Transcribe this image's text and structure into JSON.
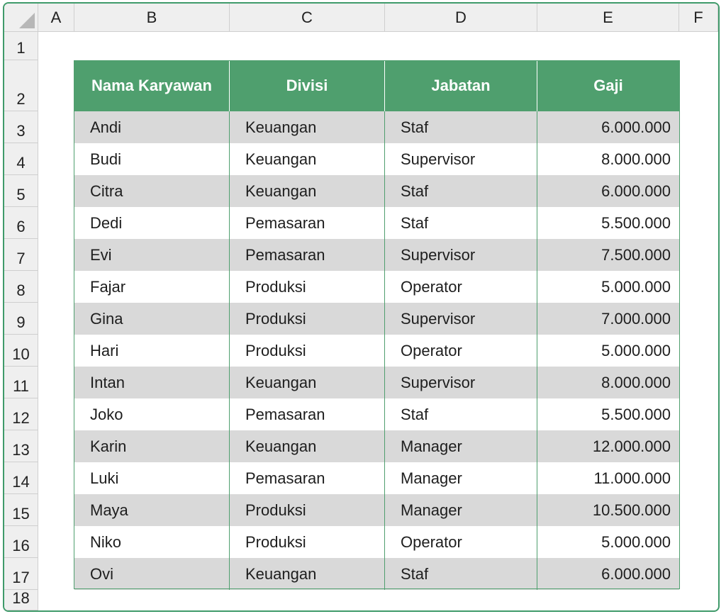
{
  "columns": [
    "A",
    "B",
    "C",
    "D",
    "E",
    "F"
  ],
  "rows": [
    "1",
    "2",
    "3",
    "4",
    "5",
    "6",
    "7",
    "8",
    "9",
    "10",
    "11",
    "12",
    "13",
    "14",
    "15",
    "16",
    "17",
    "18"
  ],
  "table": {
    "headers": [
      "Nama Karyawan",
      "Divisi",
      "Jabatan",
      "Gaji"
    ],
    "data": [
      [
        "Andi",
        "Keuangan",
        "Staf",
        "6.000.000"
      ],
      [
        "Budi",
        "Keuangan",
        "Supervisor",
        "8.000.000"
      ],
      [
        "Citra",
        "Keuangan",
        "Staf",
        "6.000.000"
      ],
      [
        "Dedi",
        "Pemasaran",
        "Staf",
        "5.500.000"
      ],
      [
        "Evi",
        "Pemasaran",
        "Supervisor",
        "7.500.000"
      ],
      [
        "Fajar",
        "Produksi",
        "Operator",
        "5.000.000"
      ],
      [
        "Gina",
        "Produksi",
        "Supervisor",
        "7.000.000"
      ],
      [
        "Hari",
        "Produksi",
        "Operator",
        "5.000.000"
      ],
      [
        "Intan",
        "Keuangan",
        "Supervisor",
        "8.000.000"
      ],
      [
        "Joko",
        "Pemasaran",
        "Staf",
        "5.500.000"
      ],
      [
        "Karin",
        "Keuangan",
        "Manager",
        "12.000.000"
      ],
      [
        "Luki",
        "Pemasaran",
        "Manager",
        "11.000.000"
      ],
      [
        "Maya",
        "Produksi",
        "Manager",
        "10.500.000"
      ],
      [
        "Niko",
        "Produksi",
        "Operator",
        "5.000.000"
      ],
      [
        "Ovi",
        "Keuangan",
        "Staf",
        "6.000.000"
      ]
    ]
  },
  "colors": {
    "header_green": "#4f9f6e",
    "band_gray": "#d9d9d9",
    "frame_green": "#3f9a6a"
  }
}
